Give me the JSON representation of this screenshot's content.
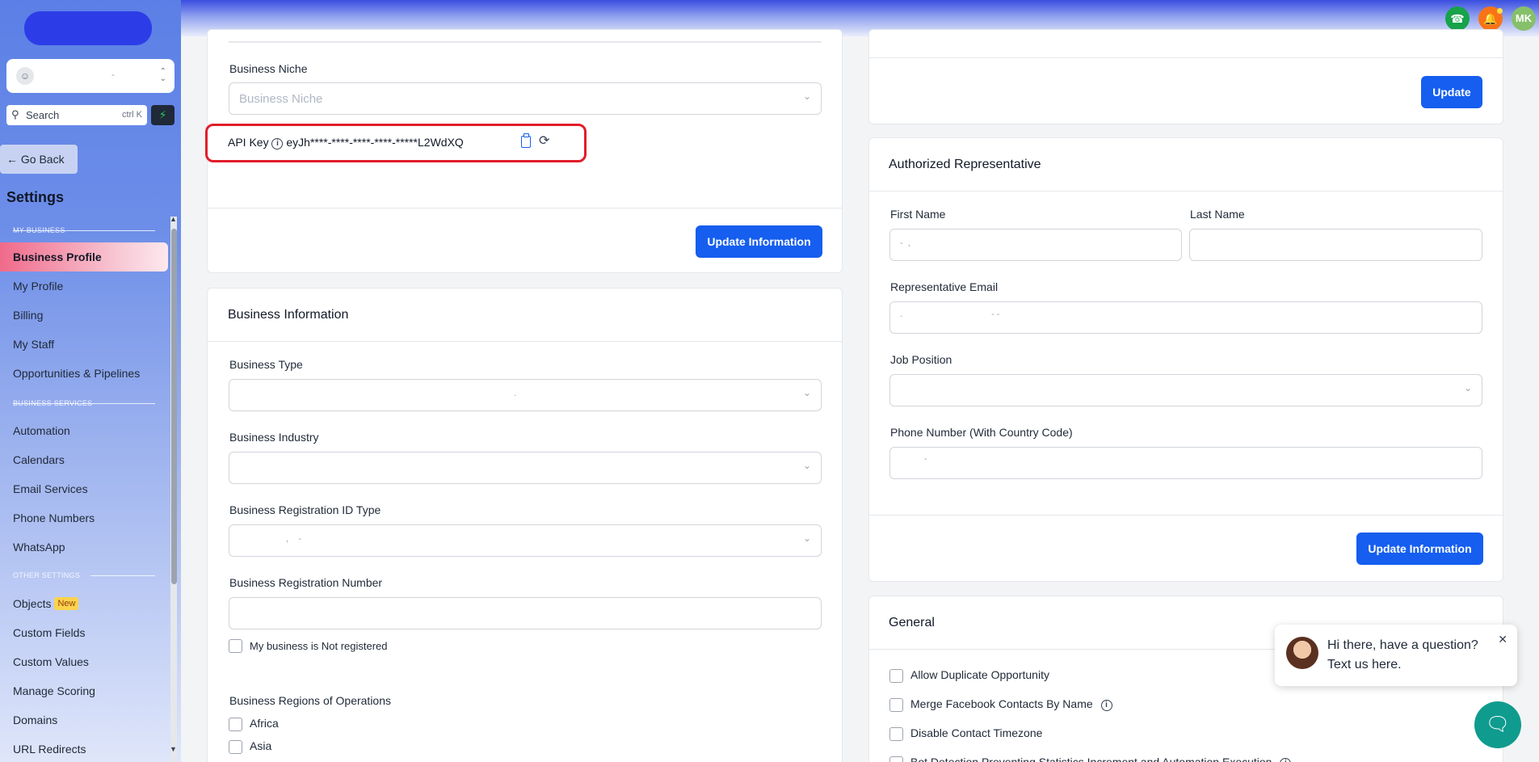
{
  "sidebar": {
    "account_value": "-",
    "search_placeholder": "Search",
    "search_shortcut": "ctrl K",
    "go_back": "Go Back",
    "title": "Settings",
    "section_my_business": "MY BUSINESS",
    "section_business_services": "BUSINESS SERVICES",
    "section_other_settings": "OTHER SETTINGS",
    "items": [
      {
        "label": "Business Profile"
      },
      {
        "label": "My Profile"
      },
      {
        "label": "Billing"
      },
      {
        "label": "My Staff"
      },
      {
        "label": "Opportunities & Pipelines"
      },
      {
        "label": "Automation"
      },
      {
        "label": "Calendars"
      },
      {
        "label": "Email Services"
      },
      {
        "label": "Phone Numbers"
      },
      {
        "label": "WhatsApp"
      },
      {
        "label": "Objects",
        "badge": "New"
      },
      {
        "label": "Custom Fields"
      },
      {
        "label": "Custom Values"
      },
      {
        "label": "Manage Scoring"
      },
      {
        "label": "Domains"
      },
      {
        "label": "URL Redirects"
      }
    ]
  },
  "topbar": {
    "avatar_initials": "MK",
    "phone_icon": "phone-icon",
    "bell_icon": "bell-icon"
  },
  "left_top_card": {
    "niche_label": "Business Niche",
    "niche_placeholder": "Business Niche",
    "api_key_label": "API Key",
    "api_key_value": "eyJh****-****-****-****-*****L2WdXQ",
    "update_button": "Update Information"
  },
  "business_info": {
    "title": "Business Information",
    "type_label": "Business Type",
    "type_value": ".",
    "industry_label": "Business Industry",
    "reg_id_type_label": "Business Registration ID Type",
    "reg_id_type_value": ",    -",
    "reg_number_label": "Business Registration Number",
    "not_registered_label": "My business is Not registered",
    "regions_label": "Business Regions of Operations",
    "regions": [
      "Africa",
      "Asia"
    ]
  },
  "right_top_card": {
    "update_button": "Update"
  },
  "authorized_rep": {
    "title": "Authorized Representative",
    "first_name_label": "First Name",
    "first_name_value": "-  ,",
    "last_name_label": "Last Name",
    "email_label": "Representative Email",
    "email_value": ".                                    - -",
    "job_label": "Job Position",
    "phone_label": "Phone Number (With Country Code)",
    "phone_value": "-",
    "update_button": "Update Information"
  },
  "general": {
    "title": "General",
    "options": [
      "Allow Duplicate Opportunity",
      "Merge Facebook Contacts By Name",
      "Disable Contact Timezone",
      "Bot Detection Preventing Statistics Increment and Automation Execution"
    ]
  },
  "chat": {
    "message": "Hi there, have a question? Text us here."
  },
  "colors": {
    "primary": "#155eef",
    "active_nav": "#f06a8a",
    "highlight_outline": "#e11d2a"
  }
}
